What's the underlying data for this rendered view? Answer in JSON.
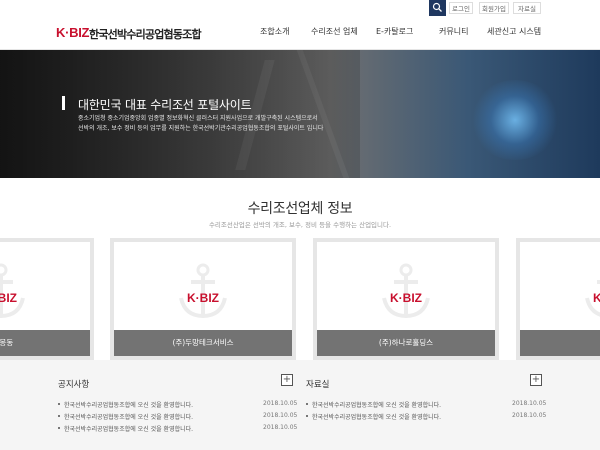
{
  "util": {
    "links": [
      "로그인",
      "회원가입",
      "자료실"
    ]
  },
  "header": {
    "logo_k": "K·BIZ",
    "org_name": "한국선박수리공업협동조합",
    "nav": [
      "조합소개",
      "수리조선 업체",
      "E-카탈로그",
      "커뮤니티",
      "세관신고 시스템"
    ]
  },
  "hero": {
    "title": "대한민국 대표 수리조선 포털사이트",
    "desc_line1": "중소기업청 중소기업중앙회 업종별 정보화혁신 클러스터 지원사업으로 개발구축된 시스템으로서",
    "desc_line2": "선박의 개조, 보수 정비 등의 업무를 지원하는 한국선박기관수리공업협동조합의 포털사이트 입니다"
  },
  "section": {
    "title": "수리조선업체 정보",
    "subtitle": "수리조선산업은 선박의 개조, 보수, 정비 등을 수행하는 산업입니다."
  },
  "cards": [
    {
      "name": "티_몽동",
      "logo": "K·BIZ"
    },
    {
      "name": "(주)두망테크서비스",
      "logo": "K·BIZ"
    },
    {
      "name": "(주)하나로홀딩스",
      "logo": "K·BIZ"
    },
    {
      "name": "",
      "logo": "K·BIZ"
    }
  ],
  "notice": {
    "title": "공지사항",
    "plus": "+",
    "items": [
      {
        "text": "한국선박수리공업협동조합에 오신 것을 환영합니다.",
        "date": "2018.10.05"
      },
      {
        "text": "한국선박수리공업협동조합에 오신 것을 환영합니다.",
        "date": "2018.10.05"
      },
      {
        "text": "한국선박수리공업협동조합에 오신 것을 환영합니다.",
        "date": "2018.10.05"
      }
    ]
  },
  "archive": {
    "title": "자료실",
    "plus": "+",
    "items": [
      {
        "text": "한국선박수리공업협동조합에 오신 것을 환영합니다.",
        "date": "2018.10.05"
      },
      {
        "text": "한국선박수리공업협동조합에 오신 것을 환영합니다.",
        "date": "2018.10.05"
      }
    ]
  },
  "colors": {
    "brand_red": "#c8102e",
    "navy": "#1f3760"
  },
  "icons": {
    "search": "search-icon",
    "anchor": "anchor-icon"
  }
}
